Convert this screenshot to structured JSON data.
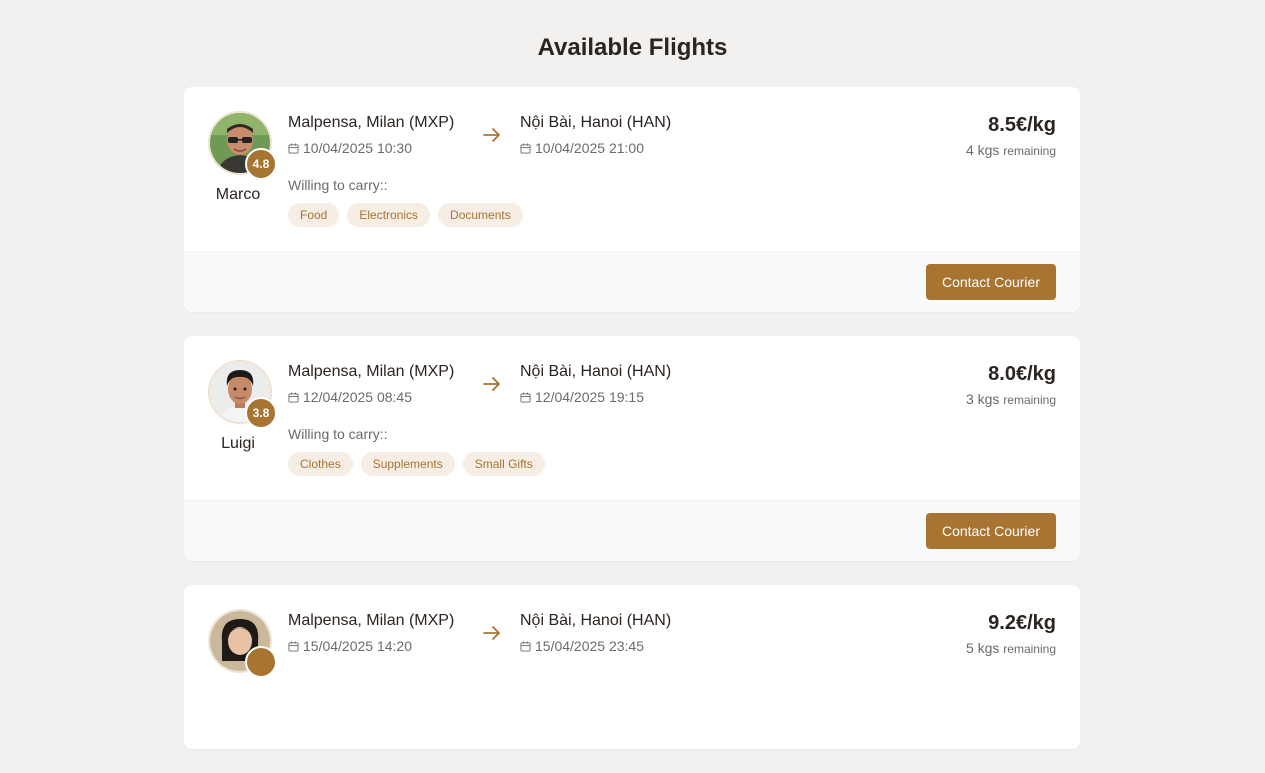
{
  "page": {
    "title": "Available Flights"
  },
  "willing_label": "Willing to carry::",
  "contact_label": "Contact Courier",
  "remaining_word": "remaining",
  "flights": [
    {
      "courier": {
        "name": "Marco",
        "rating": "4.8"
      },
      "from": {
        "airport": "Malpensa, Milan (MXP)",
        "datetime": "10/04/2025 10:30"
      },
      "to": {
        "airport": "Nội Bài, Hanoi (HAN)",
        "datetime": "10/04/2025 21:00"
      },
      "price": "8.5€/kg",
      "remaining": "4 kgs",
      "tags": [
        "Food",
        "Electronics",
        "Documents"
      ]
    },
    {
      "courier": {
        "name": "Luigi",
        "rating": "3.8"
      },
      "from": {
        "airport": "Malpensa, Milan (MXP)",
        "datetime": "12/04/2025 08:45"
      },
      "to": {
        "airport": "Nội Bài, Hanoi (HAN)",
        "datetime": "12/04/2025 19:15"
      },
      "price": "8.0€/kg",
      "remaining": "3 kgs",
      "tags": [
        "Clothes",
        "Supplements",
        "Small Gifts"
      ]
    },
    {
      "courier": {
        "name": "",
        "rating": ""
      },
      "from": {
        "airport": "Malpensa, Milan (MXP)",
        "datetime": "15/04/2025 14:20"
      },
      "to": {
        "airport": "Nội Bài, Hanoi (HAN)",
        "datetime": "15/04/2025 23:45"
      },
      "price": "9.2€/kg",
      "remaining": "5 kgs",
      "tags": []
    }
  ]
}
